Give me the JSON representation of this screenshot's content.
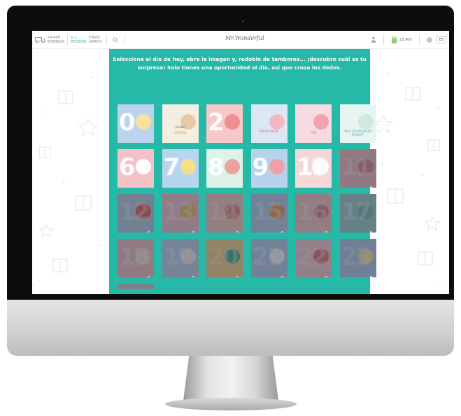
{
  "header": {
    "delivery_line1": "24-48H",
    "delivery_line2": "ENTREGA",
    "promo_line1": "+ 1",
    "promo_line2": "PEDIDOS",
    "shipping_line1": "ENVÍO",
    "shipping_line2": "GRATIS",
    "logo_text": "Mr.Wonderful",
    "cart_total": "25,90€",
    "language": "ES"
  },
  "calendar": {
    "intro": "Selecciona el día de hoy, abre la imagen y, redoble de tambores... ¡descubre cuál es tu sorpresa! Solo tienes una oportunidad al día, así que cruza los dedos.",
    "day1_text": "¡Gratis!",
    "day1_sub": "CÓDIGO",
    "day4_text": "ENVÍO GRATIS",
    "day5_text": "10%",
    "day6_text": "PASA UN PRÓSPERO PROJECT"
  },
  "days": [
    {
      "label": "0",
      "locked": false,
      "bg": "#b9d4ec",
      "deco": "#f7e2a0"
    },
    {
      "label": "",
      "locked": false,
      "bg": "#f3eee2",
      "deco": "#e9c9a8"
    },
    {
      "label": "2",
      "locked": false,
      "bg": "#f6c8c8",
      "deco": "#f08f8f"
    },
    {
      "label": "",
      "locked": false,
      "bg": "#dce7f3",
      "deco": "#f3b7c3"
    },
    {
      "label": "",
      "locked": false,
      "bg": "#f6dbe0",
      "deco": "#f2a3ad"
    },
    {
      "label": "",
      "locked": false,
      "bg": "#e8f4f1",
      "deco": "#cfe9e2"
    },
    {
      "label": "6",
      "locked": false,
      "bg": "#f4c1c9",
      "deco": "#ffffff"
    },
    {
      "label": "7",
      "locked": false,
      "bg": "#b6d6ee",
      "deco": "#f7df8a"
    },
    {
      "label": "8",
      "locked": false,
      "bg": "#dff1e8",
      "deco": "#e9a3a3"
    },
    {
      "label": "9",
      "locked": false,
      "bg": "#b7d3ec",
      "deco": "#f2a0a8"
    },
    {
      "label": "10",
      "locked": false,
      "bg": "#f6d7d7",
      "deco": "#ffffff"
    },
    {
      "label": "11",
      "locked": true,
      "bg": "#f0c3c6",
      "deco": "#e58d93"
    },
    {
      "label": "12",
      "locked": true,
      "bg": "#b8d0e8",
      "deco": "#e66a6a"
    },
    {
      "label": "13",
      "locked": true,
      "bg": "#f4c8cf",
      "deco": "#f0c069"
    },
    {
      "label": "14",
      "locked": true,
      "bg": "#f6d0c4",
      "deco": "#e98b7b"
    },
    {
      "label": "15",
      "locked": true,
      "bg": "#b8d4ed",
      "deco": "#e4a36c"
    },
    {
      "label": "16",
      "locked": true,
      "bg": "#f4cbc8",
      "deco": "#e48a8a"
    },
    {
      "label": "17",
      "locked": true,
      "bg": "#9fd4cf",
      "deco": "#7fc4b8"
    },
    {
      "label": "18",
      "locked": true,
      "bg": "#f1c6cc",
      "deco": "#f5e2d0"
    },
    {
      "label": "19",
      "locked": true,
      "bg": "#bfd8f0",
      "deco": "#f6f3f0"
    },
    {
      "label": "20",
      "locked": true,
      "bg": "#f5d58c",
      "deco": "#4fb38a"
    },
    {
      "label": "21",
      "locked": true,
      "bg": "#b6d5ee",
      "deco": "#ffffff"
    },
    {
      "label": "22",
      "locked": true,
      "bg": "#f6cfd5",
      "deco": "#e47b7b"
    },
    {
      "label": "23",
      "locked": true,
      "bg": "#aed0ee",
      "deco": "#f7e7a6"
    },
    {
      "label": "",
      "locked": true,
      "bg": "#c9d2da",
      "deco": "#c9d2da"
    }
  ],
  "icons": {
    "truck": "truck-icon",
    "search": "search-icon",
    "user": "user-icon",
    "bag": "shopping-bag-icon",
    "globe": "globe-icon",
    "lock": "lock-icon"
  }
}
